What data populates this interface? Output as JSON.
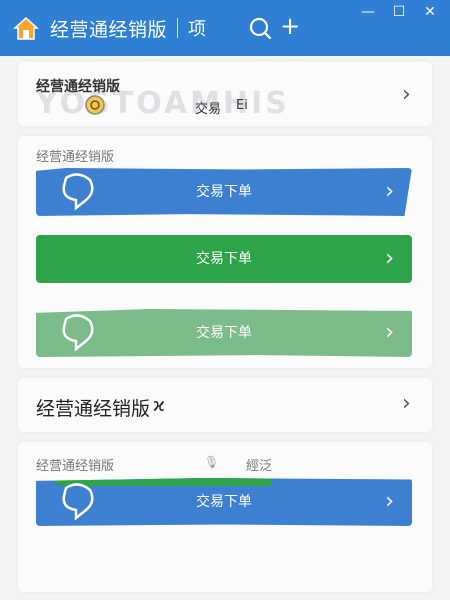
{
  "window": {
    "title": "经营通经销版",
    "tab": "项",
    "add_symbol": "+",
    "controls": {
      "minimize": "—",
      "maximize": "☐",
      "close": "✕"
    },
    "accent": "#2f7fd4"
  },
  "row1": {
    "title": "经营通经销版",
    "subtitle": "交易",
    "subtitle_suffix": "Ei",
    "watermark": "YOSTOAMHIS"
  },
  "section1": {
    "label": "经营通经销版",
    "buttons": [
      {
        "label": "交易下单",
        "color": "#3d7fd1"
      },
      {
        "label": "交易下单",
        "color": "#2ea44a"
      },
      {
        "label": "交易下单",
        "color": "#7cbc8a"
      }
    ]
  },
  "row2": {
    "title": "经营通经销版",
    "suffix": "ϰ"
  },
  "section2": {
    "label": "经营通经销版",
    "extra_label": "經泛",
    "button": {
      "label": "交易下单",
      "color": "#3d7fd1"
    }
  },
  "icons": {
    "home": "home-icon",
    "search": "search-icon",
    "chevron": "›"
  }
}
